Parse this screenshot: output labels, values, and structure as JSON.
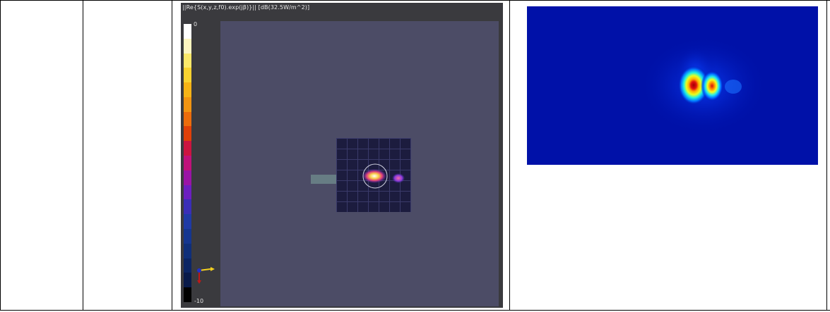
{
  "simulation": {
    "title": "||Re{S(x,y,z,f0).exp(jβ)}|| [dB(32.5W/m^2)]",
    "colorbar_max": "0",
    "colorbar_min": "-10",
    "colorbar_colors": [
      "#ffffff",
      "#fdf5c0",
      "#fbe86a",
      "#f9d230",
      "#f6b316",
      "#f29411",
      "#ec6c0c",
      "#e04009",
      "#cc1540",
      "#c0127a",
      "#9a14a6",
      "#6c1fc0",
      "#3a2eb8",
      "#1f3aa6",
      "#153690",
      "#0f2f7a",
      "#0b2564",
      "#081a4a",
      "#000000"
    ],
    "canvas_color": "#4c4c66",
    "panel_color": "#3a3a3e"
  },
  "heatmap": {
    "background": "#0011a8",
    "colormap": "jet"
  }
}
